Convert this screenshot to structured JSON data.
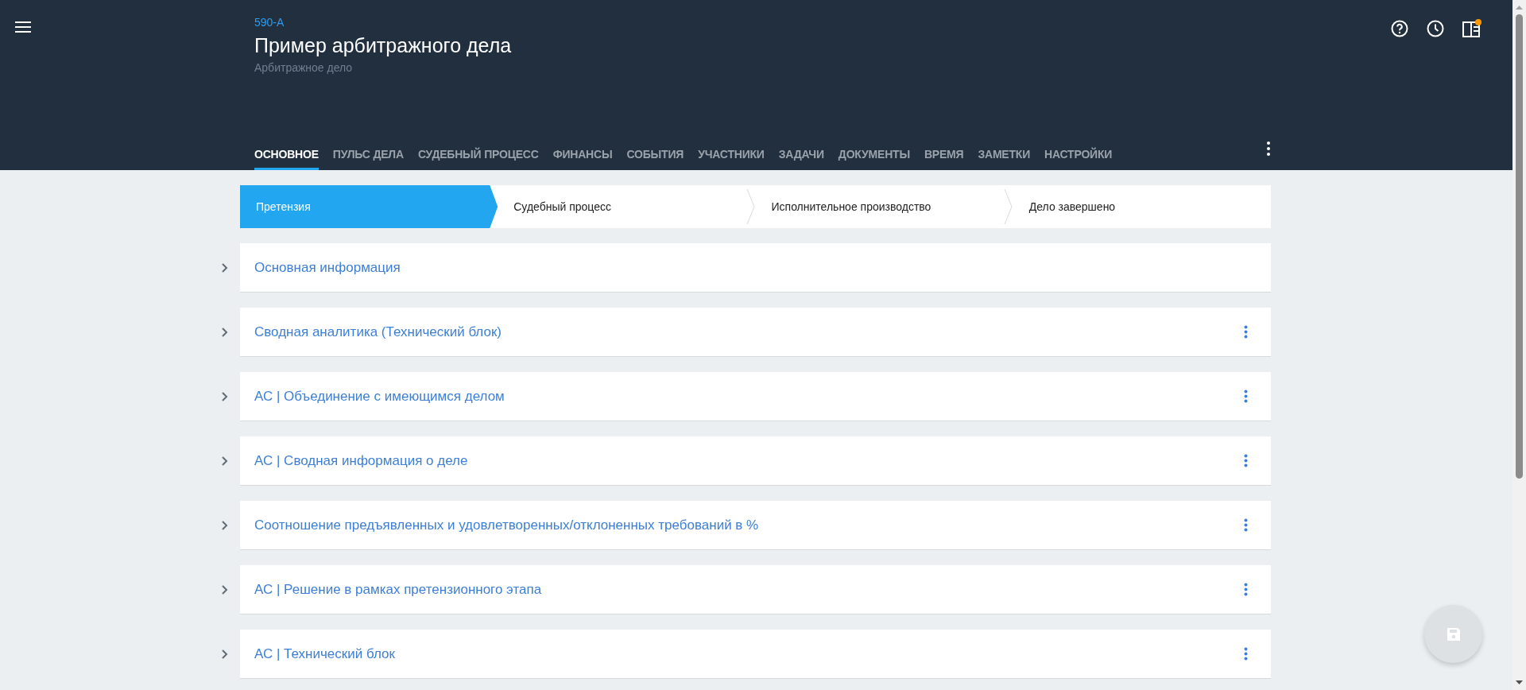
{
  "header": {
    "case_number": "590-A",
    "title": "Пример арбитражного дела",
    "subtitle": "Арбитражное дело",
    "notification_dot": true
  },
  "tabs": [
    {
      "label": "ОСНОВНОЕ",
      "selected": true
    },
    {
      "label": "ПУЛЬС ДЕЛА",
      "selected": false
    },
    {
      "label": "СУДЕБНЫЙ ПРОЦЕСС",
      "selected": false
    },
    {
      "label": "ФИНАНСЫ",
      "selected": false
    },
    {
      "label": "СОБЫТИЯ",
      "selected": false
    },
    {
      "label": "УЧАСТНИКИ",
      "selected": false
    },
    {
      "label": "ЗАДАЧИ",
      "selected": false
    },
    {
      "label": "ДОКУМЕНТЫ",
      "selected": false
    },
    {
      "label": "ВРЕМЯ",
      "selected": false
    },
    {
      "label": "ЗАМЕТКИ",
      "selected": false
    },
    {
      "label": "НАСТРОЙКИ",
      "selected": false
    }
  ],
  "stages": [
    {
      "label": "Претензия",
      "selected": true
    },
    {
      "label": "Судебный процесс",
      "selected": false
    },
    {
      "label": "Исполнительное производство",
      "selected": false
    },
    {
      "label": "Дело завершено",
      "selected": false
    }
  ],
  "sections": [
    {
      "title": "Основная информация",
      "expanded": false,
      "has_menu": false
    },
    {
      "title": "Сводная аналитика (Технический блок)",
      "expanded": false,
      "has_menu": true
    },
    {
      "title": "АС | Объединение с имеющимся делом",
      "expanded": false,
      "has_menu": true
    },
    {
      "title": "АС | Сводная информация о деле",
      "expanded": false,
      "has_menu": true
    },
    {
      "title": "Соотношение предъявленных и удовлетворенных/отклоненных требований в %",
      "expanded": false,
      "has_menu": true
    },
    {
      "title": "АС | Решение в рамках претензионного этапа",
      "expanded": false,
      "has_menu": true
    },
    {
      "title": "АС | Технический блок",
      "expanded": false,
      "has_menu": true
    }
  ],
  "save_button": {
    "disabled": true
  }
}
